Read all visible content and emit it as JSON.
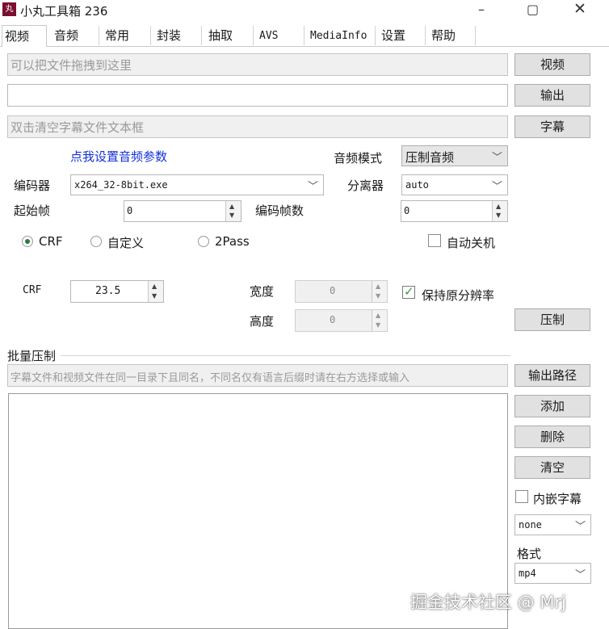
{
  "window": {
    "title": "小丸工具箱 236",
    "icon_text": "丸"
  },
  "tabs": [
    "视频",
    "音频",
    "常用",
    "封装",
    "抽取",
    "AVS",
    "MediaInfo",
    "设置",
    "帮助"
  ],
  "files": {
    "video_placeholder": "可以把文件拖拽到这里",
    "output_value": "",
    "subtitle_placeholder": "双击清空字幕文件文本框",
    "video_button": "视频",
    "output_button": "输出",
    "subtitle_button": "字幕"
  },
  "audio": {
    "link_text": "点我设置音频参数",
    "mode_label": "音频模式",
    "mode_value": "压制音频"
  },
  "encoder": {
    "label": "编码器",
    "value": "x264_32-8bit.exe",
    "separator_label": "分离器",
    "separator_value": "auto"
  },
  "frames": {
    "start_label": "起始帧",
    "start_value": "0",
    "count_label": "编码帧数",
    "count_value": "0"
  },
  "rate_modes": {
    "crf": "CRF",
    "custom": "自定义",
    "twopass": "2Pass",
    "selected": "CRF",
    "auto_shutdown": "自动关机"
  },
  "crf": {
    "label": "CRF",
    "value": "23.5",
    "width_label": "宽度",
    "width_value": "0",
    "height_label": "高度",
    "height_value": "0",
    "keep_resolution": "保持原分辨率",
    "keep_resolution_checked": true,
    "encode_button": "压制"
  },
  "batch": {
    "title": "批量压制",
    "hint": "字幕文件和视频文件在同一目录下且同名，不同名仅有语言后缀时请在右方选择或输入",
    "output_path_button": "输出路径",
    "add_button": "添加",
    "delete_button": "删除",
    "clear_button": "清空",
    "embed_subtitle": "内嵌字幕",
    "subtitle_lang_value": "none",
    "format_label": "格式",
    "format_value": "mp4"
  },
  "watermark": {
    "text": "掘金技术社区 @ Mrj"
  }
}
